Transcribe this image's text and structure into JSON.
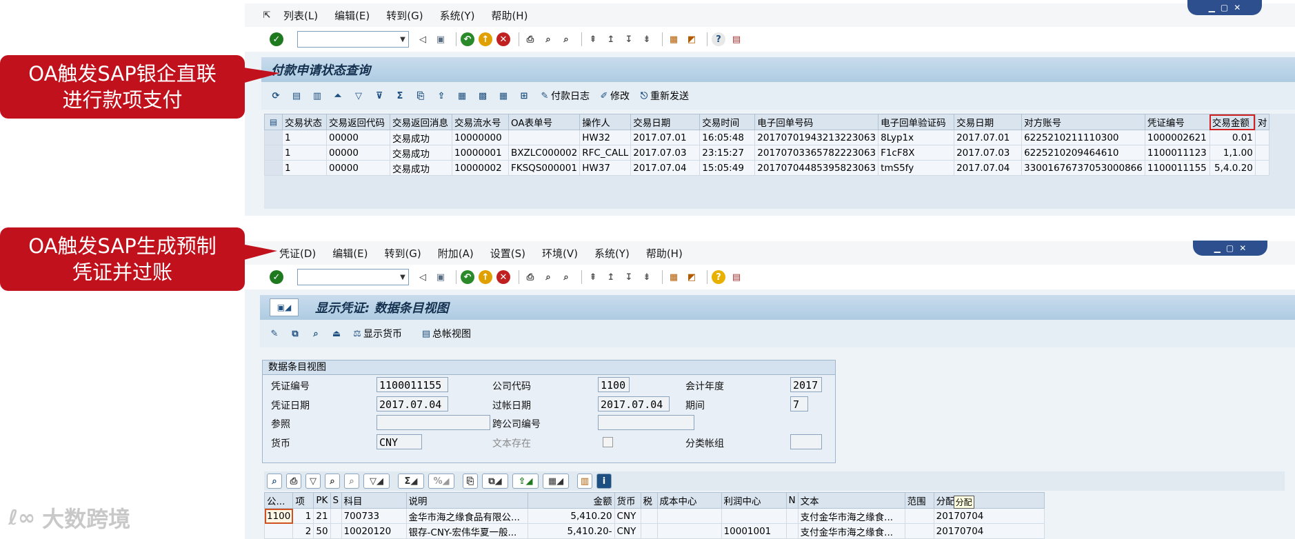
{
  "callouts": {
    "top": [
      "OA触发SAP银企直联",
      "进行款项支付"
    ],
    "bottom": [
      "OA触发SAP生成预制",
      "凭证并过账"
    ]
  },
  "window1": {
    "menu": [
      "列表(L)",
      "编辑(E)",
      "转到(G)",
      "系统(Y)",
      "帮助(H)"
    ],
    "title": "付款申请状态查询",
    "app_buttons": {
      "log": "付款日志",
      "edit": "修改",
      "resend": "重新发送"
    },
    "columns": [
      "交易状态",
      "交易返回代码",
      "交易返回消息",
      "交易流水号",
      "OA表单号",
      "操作人",
      "交易日期",
      "交易时间",
      "电子回单号码",
      "电子回单验证码",
      "交易日期",
      "对方账号",
      "凭证编号",
      "交易金额",
      "对"
    ],
    "rows": [
      [
        "1",
        "00000",
        "交易成功",
        "10000000",
        "",
        "HW32",
        "2017.07.01",
        "16:05:48",
        "20170701943213223063",
        "8Lyp1x",
        "2017.07.01",
        "6225210211110300",
        "1000002621",
        "0.01",
        ""
      ],
      [
        "1",
        "00000",
        "交易成功",
        "10000001",
        "BXZLC000002",
        "RFC_CALL",
        "2017.07.03",
        "23:15:27",
        "20170703365782223063",
        "F1cF8X",
        "2017.07.03",
        "6225210209464610",
        "1100011123",
        "1,1.00",
        ""
      ],
      [
        "1",
        "00000",
        "交易成功",
        "10000002",
        "FKSQS000001",
        "HW37",
        "2017.07.04",
        "15:05:49",
        "20170704485395823063",
        "tmS5fy",
        "2017.07.04",
        "33001676737053000866",
        "1100011155",
        "5,4.0.20",
        ""
      ]
    ]
  },
  "window2": {
    "menu": [
      "凭证(D)",
      "编辑(E)",
      "转到(G)",
      "附加(A)",
      "设置(S)",
      "环境(V)",
      "系统(Y)",
      "帮助(H)"
    ],
    "title": "显示凭证: 数据条目视图",
    "app_buttons": {
      "currency": "显示货币",
      "gl_view": "总帐视图"
    },
    "group_title": "数据条目视图",
    "fields": {
      "doc_no_label": "凭证编号",
      "doc_no": "1100011155",
      "company_label": "公司代码",
      "company": "1100",
      "fiscal_year_label": "会计年度",
      "fiscal_year": "2017",
      "doc_date_label": "凭证日期",
      "doc_date": "2017.07.04",
      "post_date_label": "过帐日期",
      "post_date": "2017.07.04",
      "period_label": "期间",
      "period": "7",
      "ref_label": "参照",
      "ref": "",
      "cross_company_label": "跨公司编号",
      "cross_company": "",
      "currency_label": "货币",
      "currency": "CNY",
      "text_exists_label": "文本存在",
      "ledger_group_label": "分类帐组",
      "ledger_group": ""
    },
    "columns": [
      "公...",
      "项",
      "PK",
      "S",
      "科目",
      "说明",
      "金额",
      "货币",
      "税",
      "成本中心",
      "利润中心",
      "N",
      "文本",
      "范围",
      "分配"
    ],
    "tooltip": "分配",
    "rows": [
      [
        "1100",
        "1",
        "21",
        "",
        "700733",
        "金华市海之缘食品有限公...",
        "5,410.20",
        "CNY",
        "",
        "",
        "",
        "",
        "支付金华市海之缘食...",
        "",
        "20170704"
      ],
      [
        "",
        "2",
        "50",
        "",
        "10020120",
        "银存-CNY-宏伟华夏一般...",
        "5,410.20-",
        "CNY",
        "",
        "",
        "10001001",
        "",
        "支付金华市海之缘食...",
        "",
        "20170704"
      ]
    ]
  },
  "watermark": "大数跨境"
}
